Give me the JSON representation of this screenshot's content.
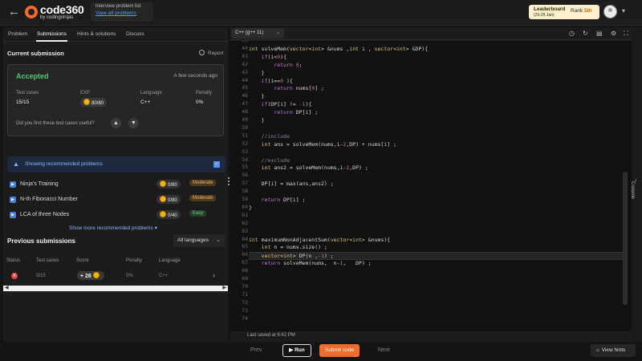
{
  "header": {
    "logo_text": "code360",
    "logo_sub": "by codingninjas",
    "breadcrumb_title": "Interview problem list",
    "breadcrumb_link": "View all problems",
    "leaderboard_title": "Leaderboard",
    "leaderboard_sub": "(20-26 Jan)",
    "rank_label": "Rank",
    "rank_value": "5th"
  },
  "left_tabs": [
    "Problem",
    "Submissions",
    "Hints & solutions",
    "Discuss"
  ],
  "current_submission": {
    "title": "Current submission",
    "report": "Report",
    "status": "Accepted",
    "time": "A few seconds ago",
    "test_cases_label": "Test cases",
    "test_cases_value": "15/15",
    "exp_label": "EXP",
    "exp_value": "80/80",
    "language_label": "Language",
    "language_value": "C++",
    "penalty_label": "Penalty",
    "penalty_value": "0%",
    "useful_question": "Did you find these test cases useful?"
  },
  "recommended": {
    "toggle_label": "Showing recommended problems",
    "items": [
      {
        "name": "Ninja's Training",
        "exp": "0/80",
        "difficulty": "Moderate"
      },
      {
        "name": "N-th Fibonacci Number",
        "exp": "0/80",
        "difficulty": "Moderate"
      },
      {
        "name": "LCA of three Nodes",
        "exp": "0/40",
        "difficulty": "Easy"
      }
    ],
    "more": "Show more recommended problems"
  },
  "previous_submissions": {
    "title": "Previous submissions",
    "filter": "All languages",
    "headers": [
      "Status",
      "Test cases",
      "Score",
      "Penalty",
      "Language"
    ],
    "rows": [
      {
        "test_cases": "5/15",
        "score": "+ 26",
        "penalty": "0%",
        "language": "C++"
      }
    ]
  },
  "editor": {
    "language": "C++ (g++ 11)",
    "last_saved": "Last saved at 6:42 PM",
    "lines": [
      {
        "n": "39",
        "t": ""
      },
      {
        "n": "40",
        "t": "int solveMem(vector<int> &nums ,int i , vector<int> &DP){"
      },
      {
        "n": "41",
        "t": "    if(i<0){"
      },
      {
        "n": "42",
        "t": "        return 0;"
      },
      {
        "n": "43",
        "t": "    }"
      },
      {
        "n": "44",
        "t": "    if(i==0 ){"
      },
      {
        "n": "45",
        "t": "        return nums[0] ;"
      },
      {
        "n": "46",
        "t": "    }"
      },
      {
        "n": "47",
        "t": "    if(DP[i] != -1){"
      },
      {
        "n": "48",
        "t": "        return DP[i] ;"
      },
      {
        "n": "49",
        "t": "    }"
      },
      {
        "n": "50",
        "t": ""
      },
      {
        "n": "51",
        "t": "    //include"
      },
      {
        "n": "52",
        "t": "    int ans = solveMem(nums,i-2,DP) + nums[i] ;"
      },
      {
        "n": "53",
        "t": ""
      },
      {
        "n": "54",
        "t": "    //exclude"
      },
      {
        "n": "55",
        "t": "    int ans2 = solveMem(nums,i-1,DP) ;"
      },
      {
        "n": "56",
        "t": ""
      },
      {
        "n": "57",
        "t": "    DP[i] = max(ans,ans2) ;"
      },
      {
        "n": "58",
        "t": ""
      },
      {
        "n": "59",
        "t": "    return DP[i] ;"
      },
      {
        "n": "60",
        "t": "}"
      },
      {
        "n": "61",
        "t": ""
      },
      {
        "n": "62",
        "t": ""
      },
      {
        "n": "63",
        "t": ""
      },
      {
        "n": "64",
        "t": "int maximumNonAdjacentSum(vector<int> &nums){"
      },
      {
        "n": "65",
        "t": "    int n = nums.size() ;"
      },
      {
        "n": "66",
        "t": "    vector<int> DP(n ,-1) ;"
      },
      {
        "n": "67",
        "t": "    return solveMem(nums,  n-1,   DP) ;"
      },
      {
        "n": "68",
        "t": ""
      },
      {
        "n": "69",
        "t": ""
      },
      {
        "n": "70",
        "t": ""
      },
      {
        "n": "71",
        "t": ""
      },
      {
        "n": "72",
        "t": ""
      },
      {
        "n": "73",
        "t": ""
      },
      {
        "n": "74",
        "t": ""
      }
    ],
    "highlight_line": "66"
  },
  "console_label": "Console",
  "bottom": {
    "prev": "Prev",
    "run": "Run",
    "submit": "Submit code",
    "next": "Next",
    "hints": "View hints"
  },
  "colors": {
    "accent": "#f26b2a",
    "accepted": "#58c26e",
    "link": "#8cb4ff"
  }
}
